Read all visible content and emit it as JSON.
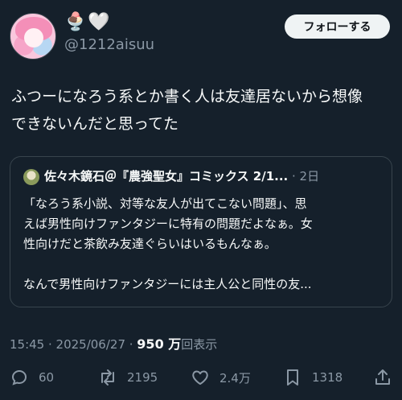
{
  "author": {
    "display_name": "🍨🤍",
    "handle": "@1212aisuu"
  },
  "follow_label": "フォローする",
  "tweet_text": "ふつーになろう系とか書く人は友達居ないから想像\nできないんだと思ってた",
  "quote": {
    "author_name": "佐々木鏡石＠『農強聖女』コミックス 2/1...",
    "time": "· 2日",
    "body": "「なろう系小説、対等な友人が出てこない問題」、思\nえば男性向けファンタジーに特有の問題だよなぁ。女\n性向けだと茶飲み友達ぐらいはいるもんなぁ。\n\nなんで男性向けファンタジーには主人公と同性の友..."
  },
  "meta": {
    "timestamp": "15:45 · 2025/06/27 · ",
    "views": "950 万",
    "views_label": "回表示"
  },
  "actions": {
    "replies": "60",
    "retweets": "2195",
    "likes": "2.4万",
    "bookmarks": "1318"
  },
  "icons": {
    "reply": "reply-icon",
    "retweet": "retweet-icon",
    "like": "heart-icon",
    "bookmark": "bookmark-icon",
    "share": "share-icon"
  },
  "colors": {
    "background": "#15202b",
    "text": "#f7f9f9",
    "secondary": "#8b98a5",
    "border": "#38444d",
    "button_bg": "#eff3f4"
  }
}
